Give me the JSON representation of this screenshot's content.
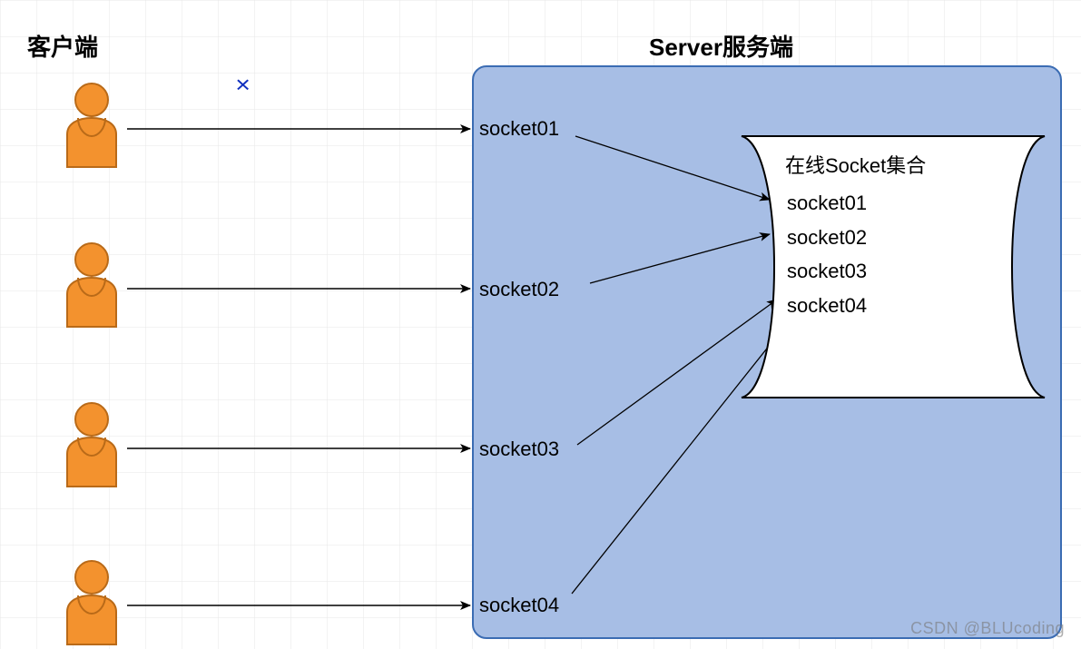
{
  "titles": {
    "client": "客户端",
    "server": "Server服务端"
  },
  "sockets": {
    "s1": "socket01",
    "s2": "socket02",
    "s3": "socket03",
    "s4": "socket04"
  },
  "collection": {
    "heading": "在线Socket集合",
    "items": [
      "socket01",
      "socket02",
      "socket03",
      "socket04"
    ]
  },
  "watermark": "CSDN @BLUcoding",
  "colors": {
    "personFill": "#F3922E",
    "personStroke": "#B96A18",
    "serverFill": "#A7BEE5",
    "serverStroke": "#3B6CB3",
    "arrow": "#000000",
    "xmark": "#1030BF"
  }
}
